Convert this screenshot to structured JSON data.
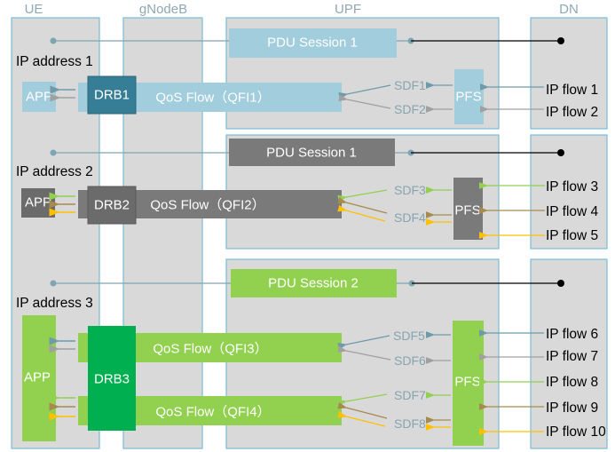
{
  "columns": {
    "ue": "UE",
    "gnodeb": "gNodeB",
    "upf": "UPF",
    "dn": "DN"
  },
  "colors": {
    "blue": "#a1cddc",
    "drb1": "#367e95",
    "grey": "#7a7a7a",
    "drb2": "#6b6b6b",
    "green": "#92d050",
    "drb3": "#00b050",
    "arrow_blue": "#6e9aaa",
    "arrow_grey": "#a0a0a0",
    "arrow_green": "#92d050",
    "arrow_brown": "#a68a50",
    "arrow_yellow": "#ffc000"
  },
  "groups": [
    {
      "ip_address": "IP address 1",
      "pdu_session": "PDU Session 1",
      "app": "APP",
      "drb": "DRB1",
      "qos_flows": [
        "QoS Flow（QFI1）"
      ],
      "sdfs": [
        "SDF1",
        "SDF2"
      ],
      "pfs": "PFS",
      "ip_flows": [
        "IP flow 1",
        "IP flow 2"
      ]
    },
    {
      "ip_address": "IP address 2",
      "pdu_session": "PDU Session 1",
      "app": "APP",
      "drb": "DRB2",
      "qos_flows": [
        "QoS Flow（QFI2）"
      ],
      "sdfs": [
        "SDF3",
        "SDF4"
      ],
      "pfs": "PFS",
      "ip_flows": [
        "IP flow 3",
        "IP flow 4",
        "IP flow 5"
      ]
    },
    {
      "ip_address": "IP address 3",
      "pdu_session": "PDU Session 2",
      "app": "APP",
      "drb": "DRB3",
      "qos_flows": [
        "QoS Flow（QFI3）",
        "QoS Flow（QFI4）"
      ],
      "sdfs": [
        "SDF5",
        "SDF6",
        "SDF7",
        "SDF8"
      ],
      "pfs": "PFS",
      "ip_flows": [
        "IP flow 6",
        "IP flow 7",
        "IP flow 8",
        "IP flow 9",
        "IP flow 10"
      ]
    }
  ]
}
